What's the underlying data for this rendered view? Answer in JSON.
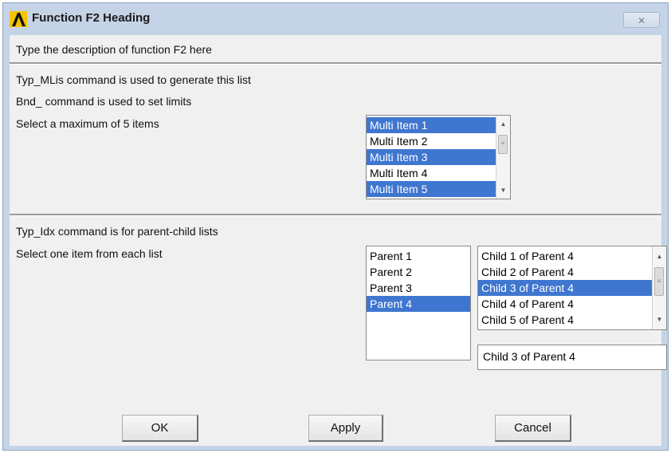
{
  "window": {
    "title": "Function F2 Heading",
    "close_glyph": "✕"
  },
  "description": "Type the description of function F2 here",
  "section1": {
    "line1": "Typ_MLis command is used to generate this list",
    "line2": "Bnd_ command is used to set limits",
    "line3": "Select a maximum of 5 items",
    "items": [
      {
        "label": "Multi Item 1",
        "selected": true
      },
      {
        "label": "Multi Item 2",
        "selected": false
      },
      {
        "label": "Multi Item 3",
        "selected": true
      },
      {
        "label": "Multi Item 4",
        "selected": false
      },
      {
        "label": "Multi Item 5",
        "selected": true
      }
    ]
  },
  "section2": {
    "line1": "Typ_Idx command is for parent-child lists",
    "line2": "Select one item from each list",
    "parents": [
      {
        "label": "Parent 1",
        "selected": false
      },
      {
        "label": "Parent 2",
        "selected": false
      },
      {
        "label": "Parent 3",
        "selected": false
      },
      {
        "label": "Parent 4",
        "selected": true
      }
    ],
    "children": [
      {
        "label": "Child 1 of Parent 4",
        "selected": false
      },
      {
        "label": "Child 2 of Parent 4",
        "selected": false
      },
      {
        "label": "Child 3 of Parent 4",
        "selected": true
      },
      {
        "label": "Child 4 of Parent 4",
        "selected": false
      },
      {
        "label": "Child 5 of Parent 4",
        "selected": false
      }
    ],
    "selected_child_value": "Child 3 of Parent 4"
  },
  "buttons": {
    "ok": "OK",
    "apply": "Apply",
    "cancel": "Cancel"
  },
  "colors": {
    "selection": "#3f76cf",
    "title_bar": "#c5d3e6",
    "client_bg": "#f0f0f0"
  },
  "icons": {
    "app": "lambda-logo-icon",
    "close": "close-icon",
    "scroll_up": "scroll-up-icon",
    "scroll_down": "scroll-down-icon"
  }
}
